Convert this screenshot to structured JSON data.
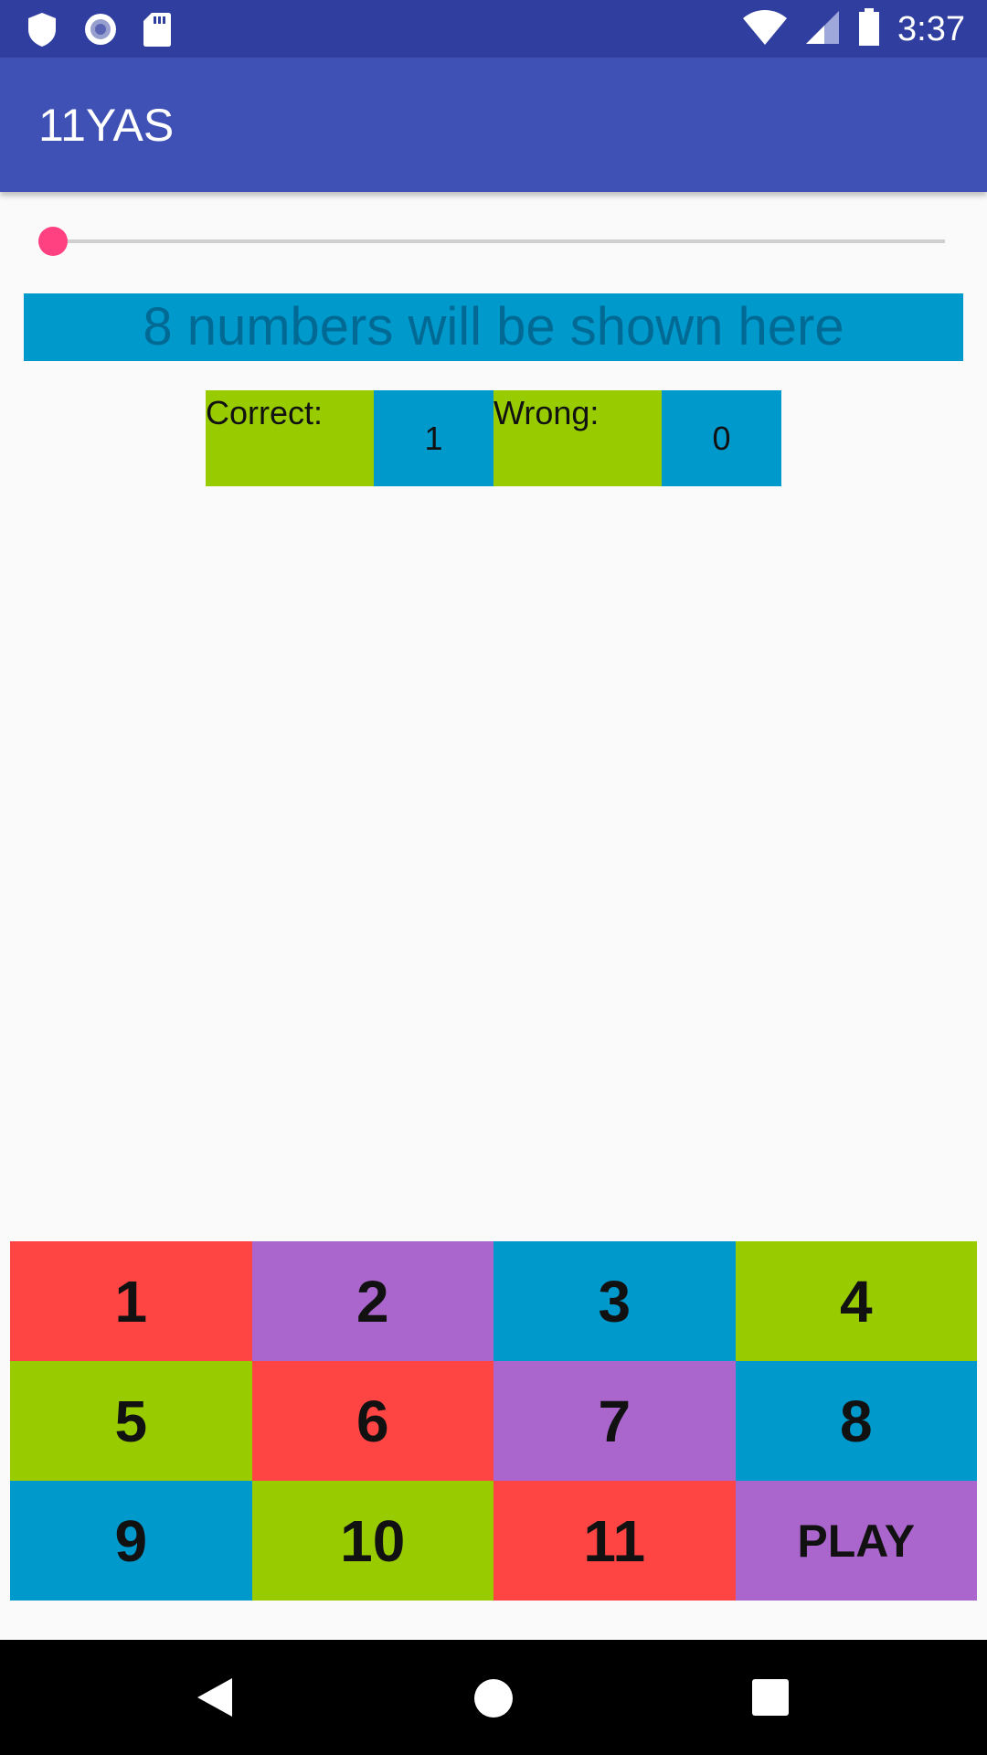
{
  "status_bar": {
    "time": "3:37",
    "icons": [
      "shield-icon",
      "sync-icon",
      "sd-card-icon",
      "wifi-icon",
      "signal-icon",
      "battery-icon"
    ]
  },
  "app_bar": {
    "title": "11YAS"
  },
  "slider": {
    "value": 0
  },
  "banner": {
    "text": "8 numbers will be shown here"
  },
  "score": {
    "correct_label": "Correct:",
    "correct_value": "1",
    "wrong_label": "Wrong:",
    "wrong_value": "0"
  },
  "keypad": {
    "keys": [
      {
        "label": "1",
        "color": "#ff4444"
      },
      {
        "label": "2",
        "color": "#aa66cc"
      },
      {
        "label": "3",
        "color": "#0099cc"
      },
      {
        "label": "4",
        "color": "#99cc00"
      },
      {
        "label": "5",
        "color": "#99cc00"
      },
      {
        "label": "6",
        "color": "#ff4444"
      },
      {
        "label": "7",
        "color": "#aa66cc"
      },
      {
        "label": "8",
        "color": "#0099cc"
      },
      {
        "label": "9",
        "color": "#0099cc"
      },
      {
        "label": "10",
        "color": "#99cc00"
      },
      {
        "label": "11",
        "color": "#ff4444"
      },
      {
        "label": "PLAY",
        "color": "#aa66cc"
      }
    ]
  },
  "nav_bar": {
    "buttons": [
      "back-icon",
      "home-icon",
      "recents-icon"
    ]
  },
  "colors": {
    "primary": "#3f51b5",
    "primary_dark": "#303f9f",
    "accent": "#ff4081",
    "green": "#99cc00",
    "blue": "#0099cc",
    "red": "#ff4444",
    "purple": "#aa66cc"
  }
}
